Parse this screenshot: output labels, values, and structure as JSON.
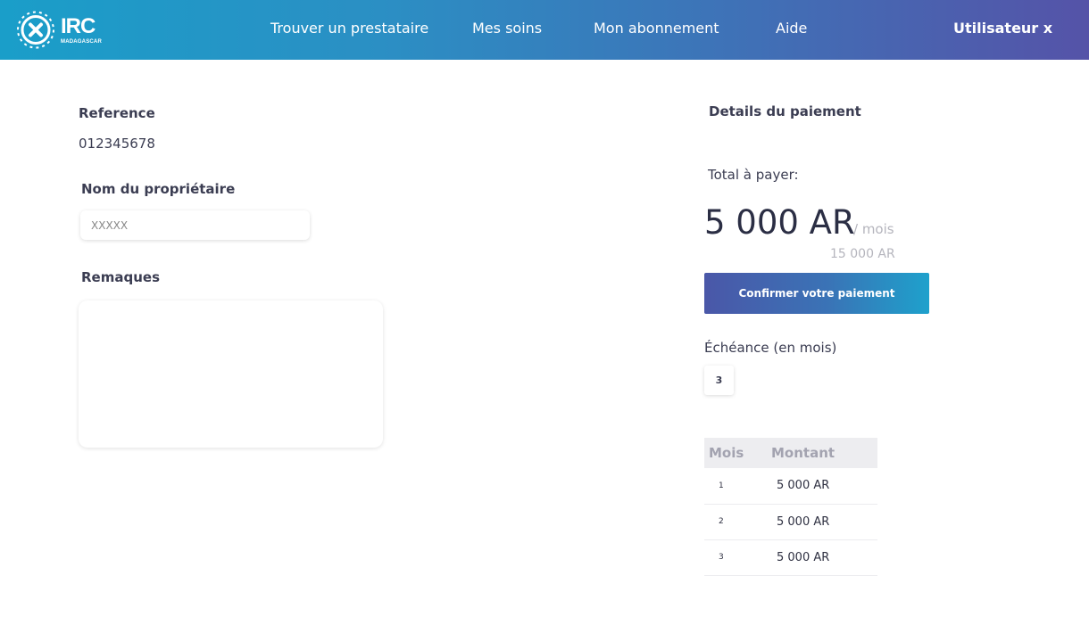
{
  "navbar": {
    "logo": {
      "text": "IRC",
      "subtext": "MADAGASCAR",
      "icon": "globe-cross-icon"
    },
    "items": [
      {
        "label": "Trouver un prestataire"
      },
      {
        "label": "Mes soins"
      },
      {
        "label": "Mon abonnement"
      },
      {
        "label": "Aide"
      }
    ],
    "user": "Utilisateur x"
  },
  "form": {
    "reference_label": "Reference",
    "reference_value": "012345678",
    "owner_label": "Nom du propriétaire",
    "owner_placeholder": "XXXXX",
    "remarks_label": "Remaques",
    "remarks_value": ""
  },
  "payment": {
    "title": "Details du paiement",
    "total_label": "Total à payer:",
    "amount": "5 000 AR",
    "per_unit": "/ mois",
    "total_amount": "15 000 AR",
    "confirm_label": "Confirmer votre paiement",
    "echeance_label": "Échéance (en mois)",
    "echeance_value": "3",
    "table": {
      "headers": [
        "Mois",
        "Montant"
      ],
      "rows": [
        {
          "mois": "1",
          "montant": "5 000 AR"
        },
        {
          "mois": "2",
          "montant": "5 000 AR"
        },
        {
          "mois": "3",
          "montant": "5 000 AR"
        }
      ]
    }
  },
  "colors": {
    "nav_gradient_start": "#1a9ec9",
    "nav_gradient_end": "#5553a8",
    "text_primary": "#3b3d52",
    "muted": "#b5b5bd"
  }
}
